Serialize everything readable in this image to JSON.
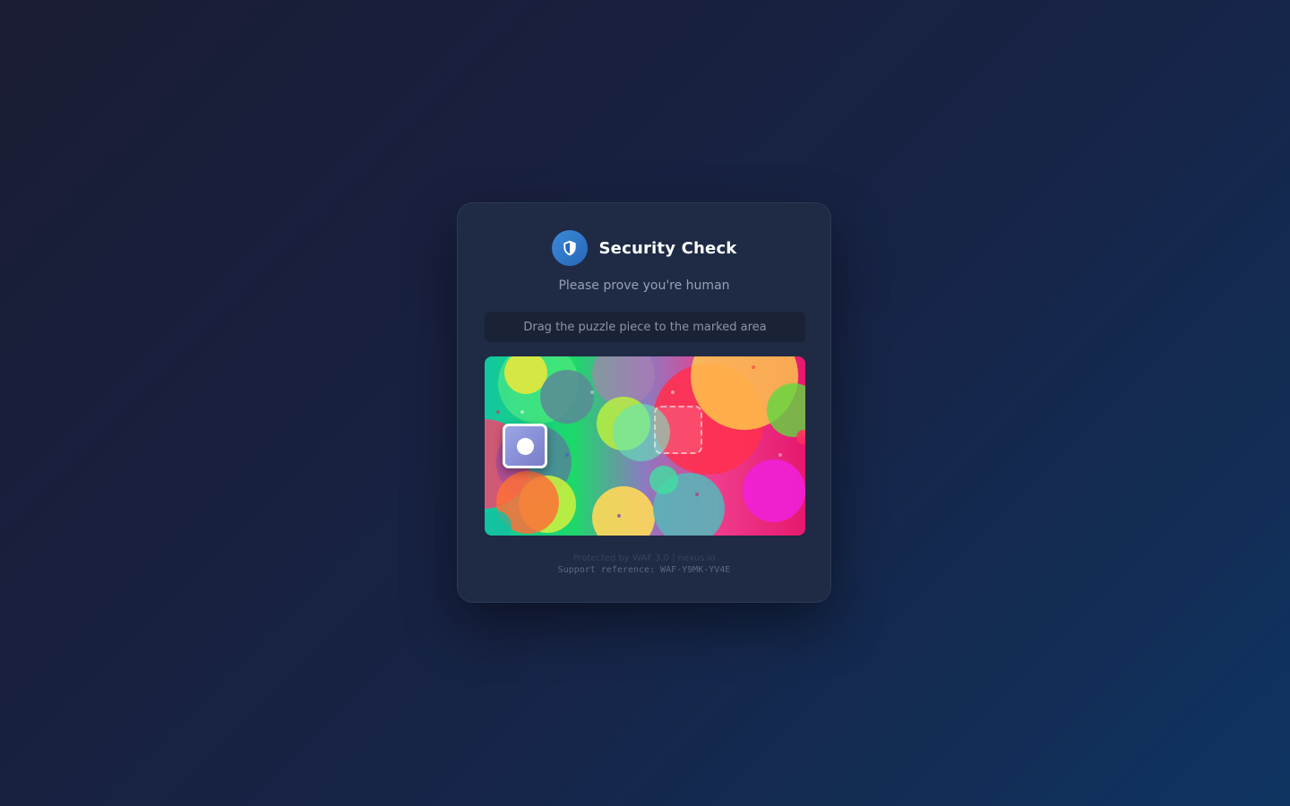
{
  "header": {
    "title": "Security Check",
    "icon": "shield-icon"
  },
  "subtitle": "Please prove you're human",
  "instruction": "Drag the puzzle piece to the marked area",
  "puzzle": {
    "piece_icon": "puzzle-piece",
    "target_icon": "dashed-target-slot"
  },
  "footer": {
    "protected_by": "Protected by WAF 3.0 | nexus.io",
    "support_reference": "Support reference: WAF-Y9MK-YV4E"
  },
  "colors": {
    "accent": "#2f7bd0",
    "card": "#1f2a44",
    "background_start": "#1a1c34",
    "background_end": "#0f3461"
  }
}
